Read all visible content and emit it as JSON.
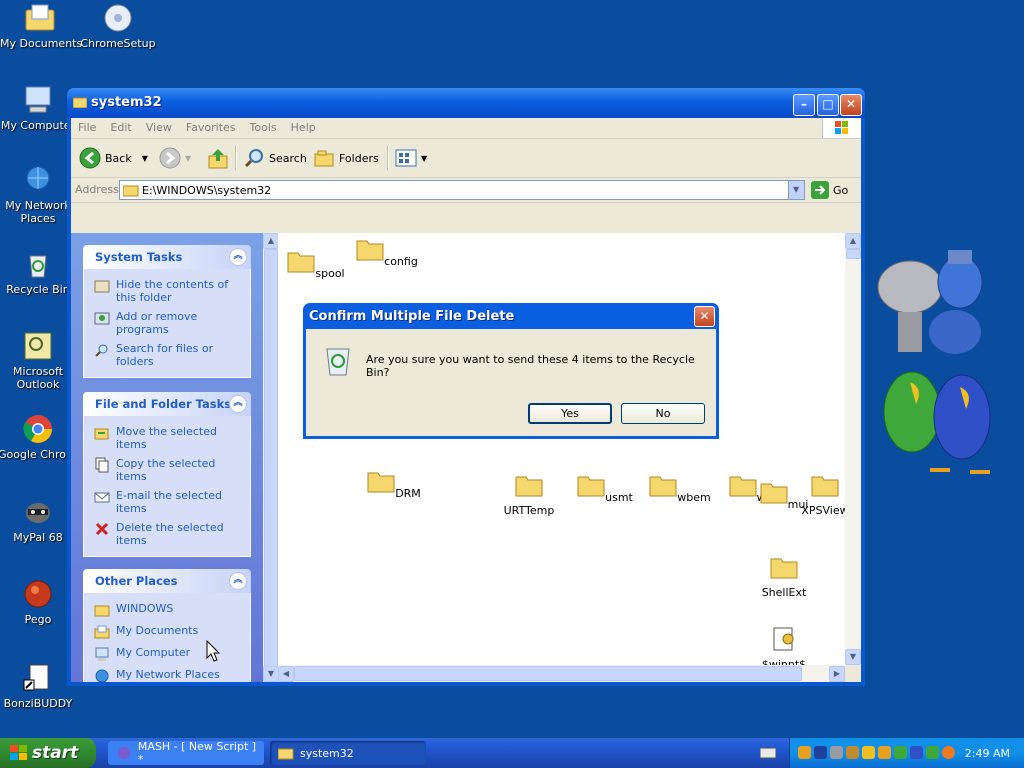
{
  "desktop": {
    "icons": [
      {
        "label": "My Documents"
      },
      {
        "label": "ChromeSetup"
      },
      {
        "label": "My Computer"
      },
      {
        "label": "My Network Places"
      },
      {
        "label": "Recycle Bin"
      },
      {
        "label": "Microsoft Outlook"
      },
      {
        "label": "Google Chrome"
      },
      {
        "label": "MyPal 68"
      },
      {
        "label": "Pego"
      },
      {
        "label": "BonziBUDDY"
      }
    ]
  },
  "window": {
    "title": "system32",
    "menu": [
      "File",
      "Edit",
      "View",
      "Favorites",
      "Tools",
      "Help"
    ],
    "toolbar": {
      "back": "Back",
      "search": "Search",
      "folders": "Folders"
    },
    "address": {
      "label": "Address",
      "value": "E:\\WINDOWS\\system32",
      "go": "Go"
    }
  },
  "left_pane": {
    "system_tasks": {
      "title": "System Tasks",
      "items": [
        "Hide the contents of this folder",
        "Add or remove programs",
        "Search for files or folders"
      ]
    },
    "file_tasks": {
      "title": "File and Folder Tasks",
      "items": [
        "Move the selected items",
        "Copy the selected items",
        "E-mail the selected items",
        "Delete the selected items"
      ]
    },
    "other_places": {
      "title": "Other Places",
      "items": [
        "WINDOWS",
        "My Documents",
        "My Computer",
        "My Network Places"
      ]
    }
  },
  "files": [
    "spool",
    "config",
    "DRM",
    "URTTemp",
    "usmt",
    "wbem",
    "wins",
    "mui",
    "XPSView",
    "ShellExt",
    "$winnt$"
  ],
  "dialog": {
    "title": "Confirm Multiple File Delete",
    "message": "Are you sure you want to send these 4 items to the Recycle Bin?",
    "yes": "Yes",
    "no": "No"
  },
  "taskbar": {
    "start": "start",
    "tasks": [
      "MASH - [ New Script ] *",
      "system32"
    ],
    "clock": "2:49 AM"
  },
  "colors": {
    "desktop": "#0a4c9e",
    "title_blue": "#0a5fe0",
    "link": "#215dc6",
    "start_green": "#2f8a2f"
  }
}
